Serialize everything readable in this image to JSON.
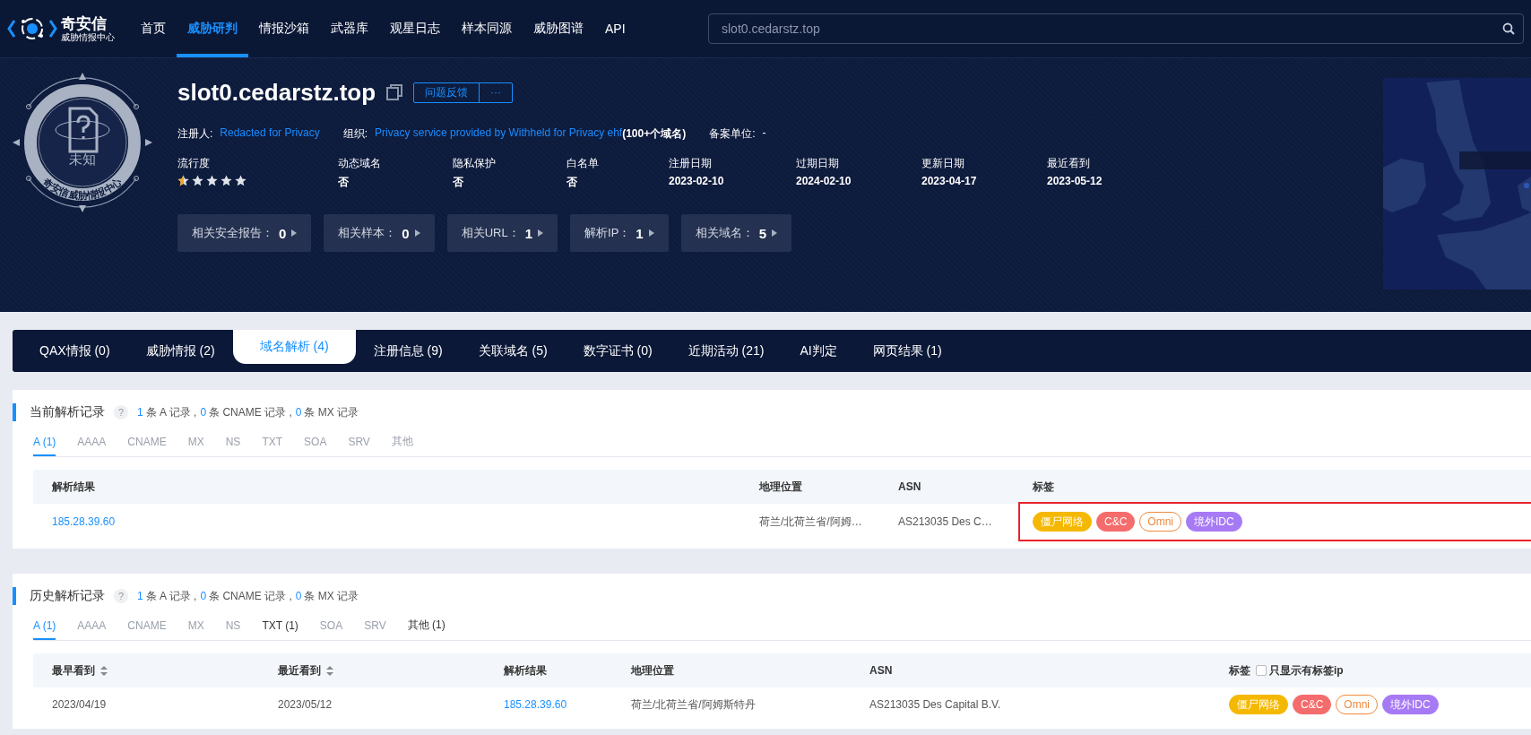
{
  "nav": {
    "logo": {
      "name": "奇安信",
      "subtitle": "威胁情报中心"
    },
    "items": [
      {
        "label": "首页",
        "selected": false
      },
      {
        "label": "威胁研判",
        "selected": true
      },
      {
        "label": "情报沙箱",
        "selected": false
      },
      {
        "label": "武器库",
        "selected": false
      },
      {
        "label": "观星日志",
        "selected": false
      },
      {
        "label": "样本同源",
        "selected": false
      },
      {
        "label": "威胁图谱",
        "selected": false
      },
      {
        "label": "API",
        "selected": false
      }
    ],
    "search": {
      "value": "slot0.cedarstz.top"
    }
  },
  "badge": {
    "label": "未知",
    "ring_text": "奇安信威胁情报中心"
  },
  "domain": {
    "title": "slot0.cedarstz.top",
    "buttons": [
      "问题反馈",
      "···"
    ]
  },
  "info": [
    {
      "label": "注册人:",
      "link": "Redacted for Privacy"
    },
    {
      "label": "组织:",
      "link": "Privacy service provided by Withheld for Privacy ehf",
      "note": "(100+个域名)"
    },
    {
      "label": "备案单位:",
      "value": "-"
    }
  ],
  "stats": [
    {
      "label": "流行度",
      "kind": "stars",
      "stars": 0.5
    },
    {
      "label": "动态域名",
      "kind": "text",
      "value": "否"
    },
    {
      "label": "隐私保护",
      "kind": "text",
      "value": "否"
    },
    {
      "label": "白名单",
      "kind": "text",
      "value": "否"
    },
    {
      "label": "注册日期",
      "kind": "text",
      "value": "2023-02-10"
    },
    {
      "label": "过期日期",
      "kind": "text",
      "value": "2024-02-10"
    },
    {
      "label": "更新日期",
      "kind": "text",
      "value": "2023-04-17"
    },
    {
      "label": "最近看到",
      "kind": "text",
      "value": "2023-05-12"
    }
  ],
  "related": [
    {
      "label": "相关安全报告：",
      "value": "0"
    },
    {
      "label": "相关样本：",
      "value": "0"
    },
    {
      "label": "相关URL：",
      "value": "1"
    },
    {
      "label": "解析IP：",
      "value": "1"
    },
    {
      "label": "相关域名：",
      "value": "5"
    }
  ],
  "tabs": [
    {
      "label": "QAX情报 (0)",
      "selected": false
    },
    {
      "label": "威胁情报 (2)",
      "selected": false
    },
    {
      "label": "域名解析 (4)",
      "selected": true
    },
    {
      "label": "注册信息 (9)",
      "selected": false
    },
    {
      "label": "关联域名 (5)",
      "selected": false
    },
    {
      "label": "数字证书 (0)",
      "selected": false
    },
    {
      "label": "近期活动 (21)",
      "selected": false
    },
    {
      "label": "AI判定",
      "selected": false
    },
    {
      "label": "网页结果 (1)",
      "selected": false
    }
  ],
  "sections": [
    {
      "title": "当前解析记录",
      "help": "?",
      "summary": [
        {
          "count": "1",
          "text": "条 A 记录 ,"
        },
        {
          "count": "0",
          "text": "条 CNAME 记录 ,"
        },
        {
          "count": "0",
          "text": "条 MX 记录"
        }
      ],
      "record_tabs": [
        {
          "label": "A (1)",
          "selected": true,
          "disabled": false
        },
        {
          "label": "AAAA",
          "selected": false,
          "disabled": true
        },
        {
          "label": "CNAME",
          "selected": false,
          "disabled": true
        },
        {
          "label": "MX",
          "selected": false,
          "disabled": true
        },
        {
          "label": "NS",
          "selected": false,
          "disabled": true
        },
        {
          "label": "TXT",
          "selected": false,
          "disabled": true
        },
        {
          "label": "SOA",
          "selected": false,
          "disabled": true
        },
        {
          "label": "SRV",
          "selected": false,
          "disabled": true
        },
        {
          "label": "其他",
          "selected": false,
          "disabled": true
        }
      ],
      "table": {
        "columns": [
          {
            "label": "解析结果"
          },
          {
            "label": "地理位置"
          },
          {
            "label": "ASN"
          },
          {
            "label": "标签"
          }
        ],
        "rows": [
          {
            "cells": [
              {
                "kind": "link",
                "text": "185.28.39.60"
              },
              {
                "kind": "text",
                "text": "荷兰/北荷兰省/阿姆…"
              },
              {
                "kind": "text",
                "text": "AS213035 Des C…"
              },
              {
                "kind": "tags",
                "highlighted": true,
                "tags": [
                  {
                    "label": "僵尸网络",
                    "kind": "filled",
                    "color": "#f5b800"
                  },
                  {
                    "label": "C&C",
                    "kind": "filled",
                    "color": "#f56c6c"
                  },
                  {
                    "label": "Omni",
                    "kind": "outline",
                    "color": "#f08a3c"
                  },
                  {
                    "label": "境外IDC",
                    "kind": "filled",
                    "color": "#a77af5"
                  }
                ]
              }
            ]
          }
        ]
      }
    },
    {
      "title": "历史解析记录",
      "help": "?",
      "summary": [
        {
          "count": "1",
          "text": "条 A 记录 ,"
        },
        {
          "count": "0",
          "text": "条 CNAME 记录 ,"
        },
        {
          "count": "0",
          "text": "条 MX 记录"
        }
      ],
      "record_tabs": [
        {
          "label": "A (1)",
          "selected": true,
          "disabled": false
        },
        {
          "label": "AAAA",
          "selected": false,
          "disabled": true
        },
        {
          "label": "CNAME",
          "selected": false,
          "disabled": true
        },
        {
          "label": "MX",
          "selected": false,
          "disabled": true
        },
        {
          "label": "NS",
          "selected": false,
          "disabled": true
        },
        {
          "label": "TXT (1)",
          "selected": false,
          "disabled": false
        },
        {
          "label": "SOA",
          "selected": false,
          "disabled": true
        },
        {
          "label": "SRV",
          "selected": false,
          "disabled": true
        },
        {
          "label": "其他 (1)",
          "selected": false,
          "disabled": false
        }
      ],
      "table": {
        "columns": [
          {
            "label": "最早看到",
            "sortable": true
          },
          {
            "label": "最近看到",
            "sortable": true
          },
          {
            "label": "解析结果"
          },
          {
            "label": "地理位置"
          },
          {
            "label": "ASN"
          },
          {
            "label": "标签",
            "filter": {
              "label": "只显示有标签ip",
              "checked": false
            }
          }
        ],
        "rows": [
          {
            "cells": [
              {
                "kind": "text",
                "text": "2023/04/19"
              },
              {
                "kind": "text",
                "text": "2023/05/12"
              },
              {
                "kind": "link",
                "text": "185.28.39.60"
              },
              {
                "kind": "text",
                "text": "荷兰/北荷兰省/阿姆斯特丹"
              },
              {
                "kind": "text",
                "text": "AS213035 Des Capital B.V."
              },
              {
                "kind": "tags",
                "tags": [
                  {
                    "label": "僵尸网络",
                    "kind": "filled",
                    "color": "#f5b800"
                  },
                  {
                    "label": "C&C",
                    "kind": "filled",
                    "color": "#f56c6c"
                  },
                  {
                    "label": "Omni",
                    "kind": "outline",
                    "color": "#f08a3c"
                  },
                  {
                    "label": "境外IDC",
                    "kind": "filled",
                    "color": "#a77af5"
                  }
                ]
              }
            ]
          }
        ]
      }
    }
  ]
}
